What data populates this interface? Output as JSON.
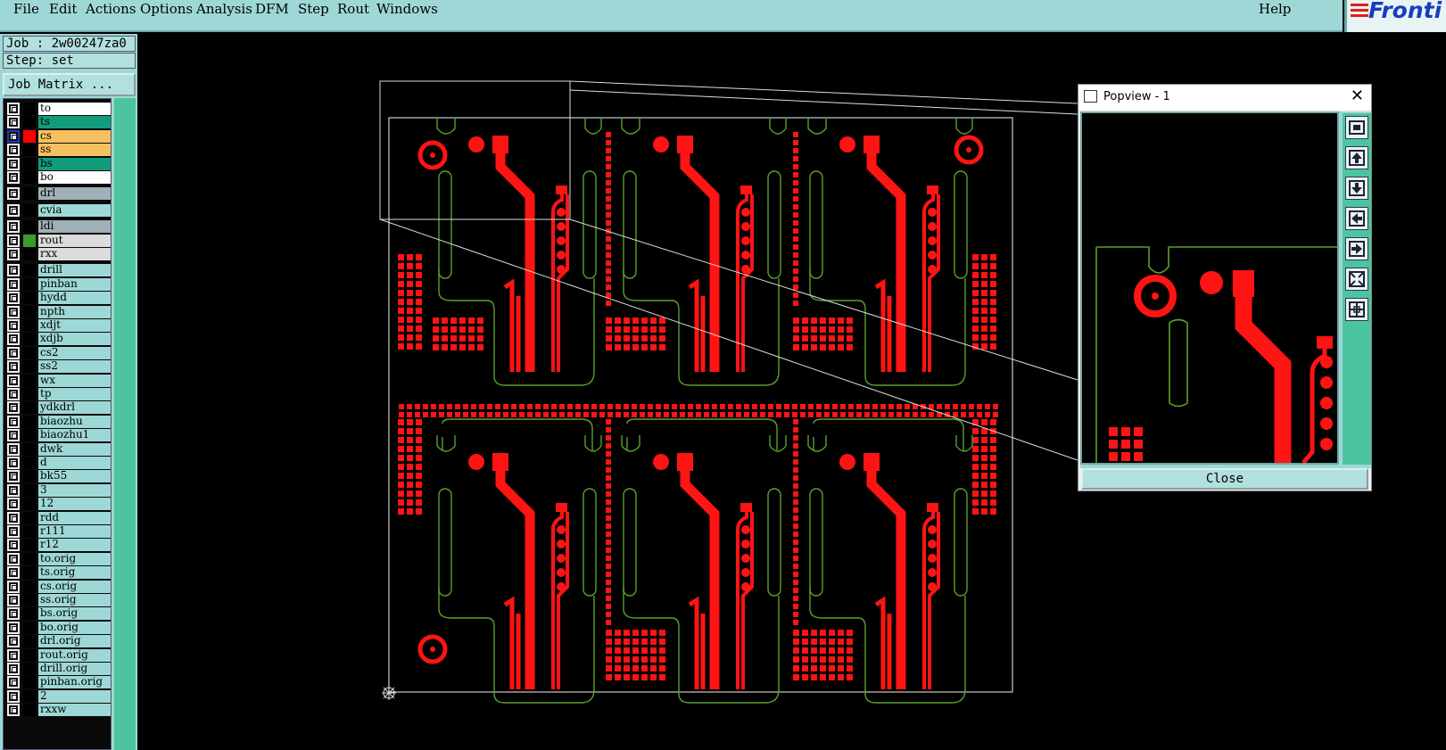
{
  "menu": {
    "items": [
      "File",
      "Edit",
      "Actions",
      "Options",
      "Analysis",
      "DFM",
      "Step",
      "Rout",
      "Windows"
    ],
    "help": "Help"
  },
  "logo": {
    "text": "Fronti"
  },
  "job": {
    "job_line": "Job : 2w00247za0",
    "step_line": "Step: set",
    "matrix_button": "Job Matrix ..."
  },
  "layers": [
    {
      "name": "to",
      "color": "#ffffff",
      "swatch": ""
    },
    {
      "name": "ts",
      "color": "#139c7c",
      "swatch": ""
    },
    {
      "name": "cs",
      "color": "#f5c060",
      "swatch": "#ff0000",
      "selected": true
    },
    {
      "name": "ss",
      "color": "#f5c060",
      "swatch": ""
    },
    {
      "name": "bs",
      "color": "#139c7c",
      "swatch": ""
    },
    {
      "name": "bo",
      "color": "#ffffff",
      "swatch": ""
    },
    {
      "name": "drl",
      "color": "#a0b0b8",
      "swatch": ""
    },
    {
      "name": "cvia",
      "color": "#9ed8d6",
      "swatch": ""
    },
    {
      "name": "ldi",
      "color": "#a0b0b8",
      "swatch": ""
    },
    {
      "name": "rout",
      "color": "#dcdcdc",
      "swatch": "#3a9c2a"
    },
    {
      "name": "rxx",
      "color": "#dcdcdc",
      "swatch": ""
    },
    {
      "name": "drill",
      "color": "#9ed8d6",
      "swatch": ""
    },
    {
      "name": "pinban",
      "color": "#9ed8d6",
      "swatch": ""
    },
    {
      "name": "hydd",
      "color": "#9ed8d6",
      "swatch": ""
    },
    {
      "name": "npth",
      "color": "#9ed8d6",
      "swatch": ""
    },
    {
      "name": "xdjt",
      "color": "#9ed8d6",
      "swatch": ""
    },
    {
      "name": "xdjb",
      "color": "#9ed8d6",
      "swatch": ""
    },
    {
      "name": "cs2",
      "color": "#9ed8d6",
      "swatch": ""
    },
    {
      "name": "ss2",
      "color": "#9ed8d6",
      "swatch": ""
    },
    {
      "name": "wx",
      "color": "#9ed8d6",
      "swatch": ""
    },
    {
      "name": "tp",
      "color": "#9ed8d6",
      "swatch": ""
    },
    {
      "name": "ydkdrl",
      "color": "#9ed8d6",
      "swatch": ""
    },
    {
      "name": "biaozhu",
      "color": "#9ed8d6",
      "swatch": ""
    },
    {
      "name": "biaozhu1",
      "color": "#9ed8d6",
      "swatch": ""
    },
    {
      "name": "dwk",
      "color": "#9ed8d6",
      "swatch": ""
    },
    {
      "name": "d",
      "color": "#9ed8d6",
      "swatch": ""
    },
    {
      "name": "bk55",
      "color": "#9ed8d6",
      "swatch": ""
    },
    {
      "name": "3",
      "color": "#9ed8d6",
      "swatch": ""
    },
    {
      "name": "12",
      "color": "#9ed8d6",
      "swatch": ""
    },
    {
      "name": "rdd",
      "color": "#9ed8d6",
      "swatch": ""
    },
    {
      "name": "r111",
      "color": "#9ed8d6",
      "swatch": ""
    },
    {
      "name": "r12",
      "color": "#9ed8d6",
      "swatch": ""
    },
    {
      "name": "to.orig",
      "color": "#9ed8d6",
      "swatch": ""
    },
    {
      "name": "ts.orig",
      "color": "#9ed8d6",
      "swatch": ""
    },
    {
      "name": "cs.orig",
      "color": "#9ed8d6",
      "swatch": ""
    },
    {
      "name": "ss.orig",
      "color": "#9ed8d6",
      "swatch": ""
    },
    {
      "name": "bs.orig",
      "color": "#9ed8d6",
      "swatch": ""
    },
    {
      "name": "bo.orig",
      "color": "#9ed8d6",
      "swatch": ""
    },
    {
      "name": "drl.orig",
      "color": "#9ed8d6",
      "swatch": ""
    },
    {
      "name": "rout.orig",
      "color": "#9ed8d6",
      "swatch": ""
    },
    {
      "name": "drill.orig",
      "color": "#9ed8d6",
      "swatch": ""
    },
    {
      "name": "pinban.orig",
      "color": "#9ed8d6",
      "swatch": ""
    },
    {
      "name": "2",
      "color": "#9ed8d6",
      "swatch": ""
    },
    {
      "name": "rxxw",
      "color": "#9ed8d6",
      "swatch": ""
    }
  ],
  "popview": {
    "title": "Popview - 1",
    "close_label": "Close",
    "close_glyph": "✕"
  },
  "colors": {
    "copper": "#ff1414",
    "rout": "#5aa02c",
    "profile": "#cccccc",
    "panel": "#9ed8d6"
  }
}
